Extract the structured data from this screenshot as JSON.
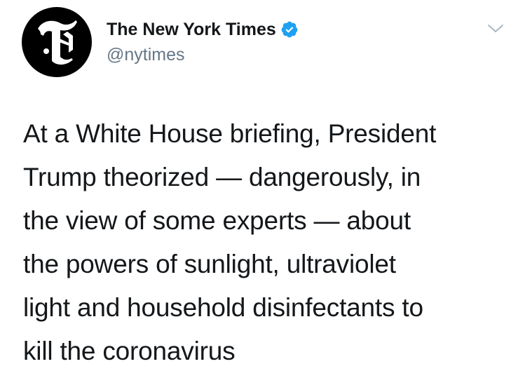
{
  "tweet": {
    "author": {
      "display_name": "The New York Times",
      "handle": "@nytimes",
      "verified": true,
      "avatar_icon": "nyt-logo-icon"
    },
    "menu_icon": "chevron-down-icon",
    "text_lines": [
      "At a White House briefing, President",
      "Trump theorized — dangerously, in",
      "the view of some experts — about",
      "the powers of sunlight, ultraviolet",
      "light and household disinfectants to",
      "kill the coronavirus"
    ]
  },
  "colors": {
    "verified_badge": "#1da1f2",
    "handle_text": "#657786",
    "primary_text": "#14171a",
    "avatar_background": "#000000"
  }
}
